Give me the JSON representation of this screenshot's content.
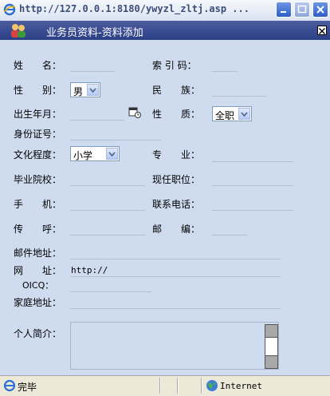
{
  "window": {
    "title": "http://127.0.0.1:8180/ywyzl_zltj.asp ..."
  },
  "dialog": {
    "title": "业务员资料-资料添加"
  },
  "form": {
    "name_label": "姓　　名：",
    "index_code_label": "索 引 码：",
    "gender_label": "性　　别：",
    "gender_value": "男",
    "ethnicity_label": "民　　族：",
    "birth_label": "出生年月：",
    "nature_label": "性　　质：",
    "nature_value": "全职",
    "id_label": "身份证号：",
    "education_label": "文化程度：",
    "education_value": "小学",
    "major_label": "专　　业：",
    "school_label": "毕业院校：",
    "position_label": "现任职位：",
    "mobile_label": "手　　机：",
    "phone_label": "联系电话：",
    "pager_label": "传　　呼：",
    "postcode_label": "邮　　编：",
    "address_label": "邮件地址：",
    "url_label": "网　　址：",
    "url_value": "http://",
    "oicq_label": "OICQ：",
    "home_label": "家庭地址：",
    "intro_label": "个人简介："
  },
  "statusbar": {
    "status": "完毕",
    "zone": "Internet"
  },
  "colors": {
    "form_bg": "#cfdcef",
    "header_bg": "#2b3f86"
  }
}
